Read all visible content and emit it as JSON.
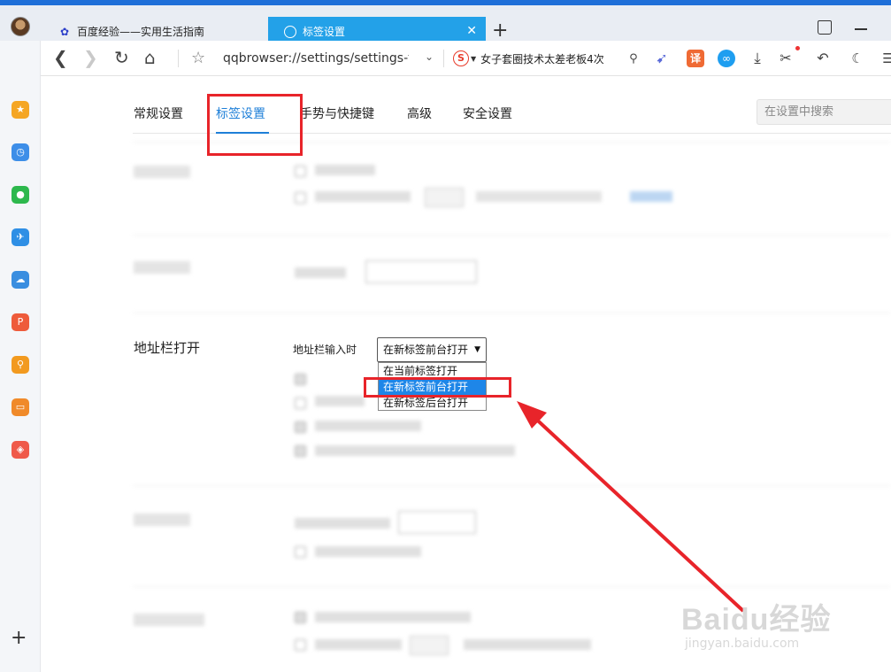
{
  "tabs": [
    {
      "title": "百度经验——实用生活指南",
      "icon": "baidu-paw-icon"
    },
    {
      "title": "标签设置",
      "icon": "settings-icon",
      "active": true
    }
  ],
  "toolbar": {
    "url": "qqbrowser://settings/settings-ta",
    "search_text": "女子套圈技术太差老板4次",
    "translate_label": "译"
  },
  "settings_tabs": [
    "常规设置",
    "标签设置",
    "手势与快捷键",
    "高级",
    "安全设置"
  ],
  "settings_search_placeholder": "在设置中搜索",
  "address_section": {
    "title": "地址栏打开",
    "label": "地址栏输入时",
    "selected": "在新标签前台打开",
    "options": [
      "在当前标签打开",
      "在新标签前台打开",
      "在新标签后台打开"
    ]
  },
  "watermark": {
    "brand": "Baidu经验",
    "url": "jingyan.baidu.com"
  },
  "colors": {
    "accent": "#1e7fd8",
    "active_tab": "#23a1e8",
    "annotation": "#e8242a"
  }
}
